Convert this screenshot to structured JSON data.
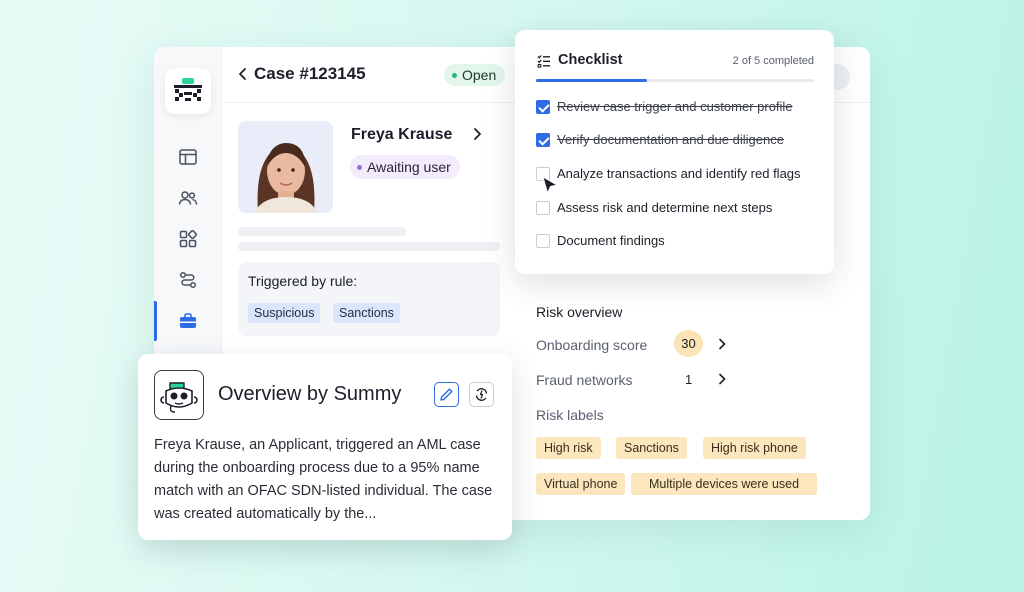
{
  "case": {
    "title": "Case #123145",
    "status": "Open"
  },
  "sidebar": {
    "items": [
      {
        "icon": "layout-icon"
      },
      {
        "icon": "users-icon"
      },
      {
        "icon": "widgets-icon"
      },
      {
        "icon": "workflow-icon"
      },
      {
        "icon": "briefcase-icon",
        "active": true
      }
    ]
  },
  "profile": {
    "name": "Freya Krause",
    "status": "Awaiting user"
  },
  "rule": {
    "title": "Triggered by rule:",
    "tags": [
      "Suspicious",
      "Sanctions"
    ]
  },
  "checklist": {
    "title": "Checklist",
    "count": "2 of 5 completed",
    "progress": 0.4,
    "items": [
      {
        "label": "Review case trigger and customer profile",
        "checked": true
      },
      {
        "label": "Verify documentation and due diligence",
        "checked": true
      },
      {
        "label": "Analyze transactions and identify red flags",
        "checked": false
      },
      {
        "label": "Assess risk and determine next steps",
        "checked": false
      },
      {
        "label": "Document findings",
        "checked": false
      }
    ]
  },
  "risk": {
    "title": "Risk overview",
    "onboarding_label": "Onboarding score",
    "onboarding_score": "30",
    "fraud_label": "Fraud networks",
    "fraud_count": "1",
    "labels_title": "Risk labels",
    "labels": [
      "High risk",
      "Sanctions",
      "High risk phone",
      "Virtual phone",
      "Multiple devices were used"
    ]
  },
  "overview": {
    "title": "Overview by Summy",
    "text": "Freya Krause, an Applicant, triggered an AML case during the onboarding process due to a 95% name match with an OFAC SDN-listed individual. The case was created automatically by the..."
  },
  "colors": {
    "accent": "#2f6be4",
    "open_badge": "#e3f6ec",
    "awaiting_badge": "#f3ecfb",
    "risk_tag": "#fbe6bd",
    "rule_tag": "#dbe6fb"
  }
}
